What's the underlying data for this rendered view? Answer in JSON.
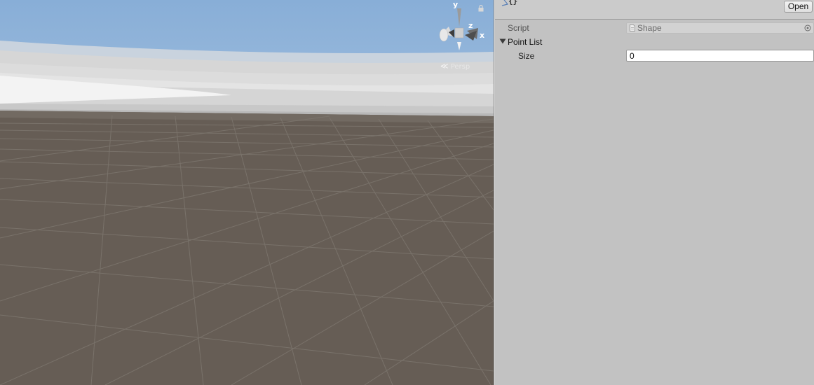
{
  "scene": {
    "gizmo": {
      "axis_y": "y",
      "axis_z": "z",
      "axis_x": "x",
      "projection_label": "Persp"
    },
    "sky_color": "#8fb3d9",
    "ground_color": "#665d55"
  },
  "inspector": {
    "header": {
      "open_label": "Open",
      "icon": "script-braces-icon"
    },
    "fields": {
      "script_label": "Script",
      "script_value": "Shape",
      "point_list_label": "Point List",
      "size_label": "Size",
      "size_value": "0"
    }
  }
}
